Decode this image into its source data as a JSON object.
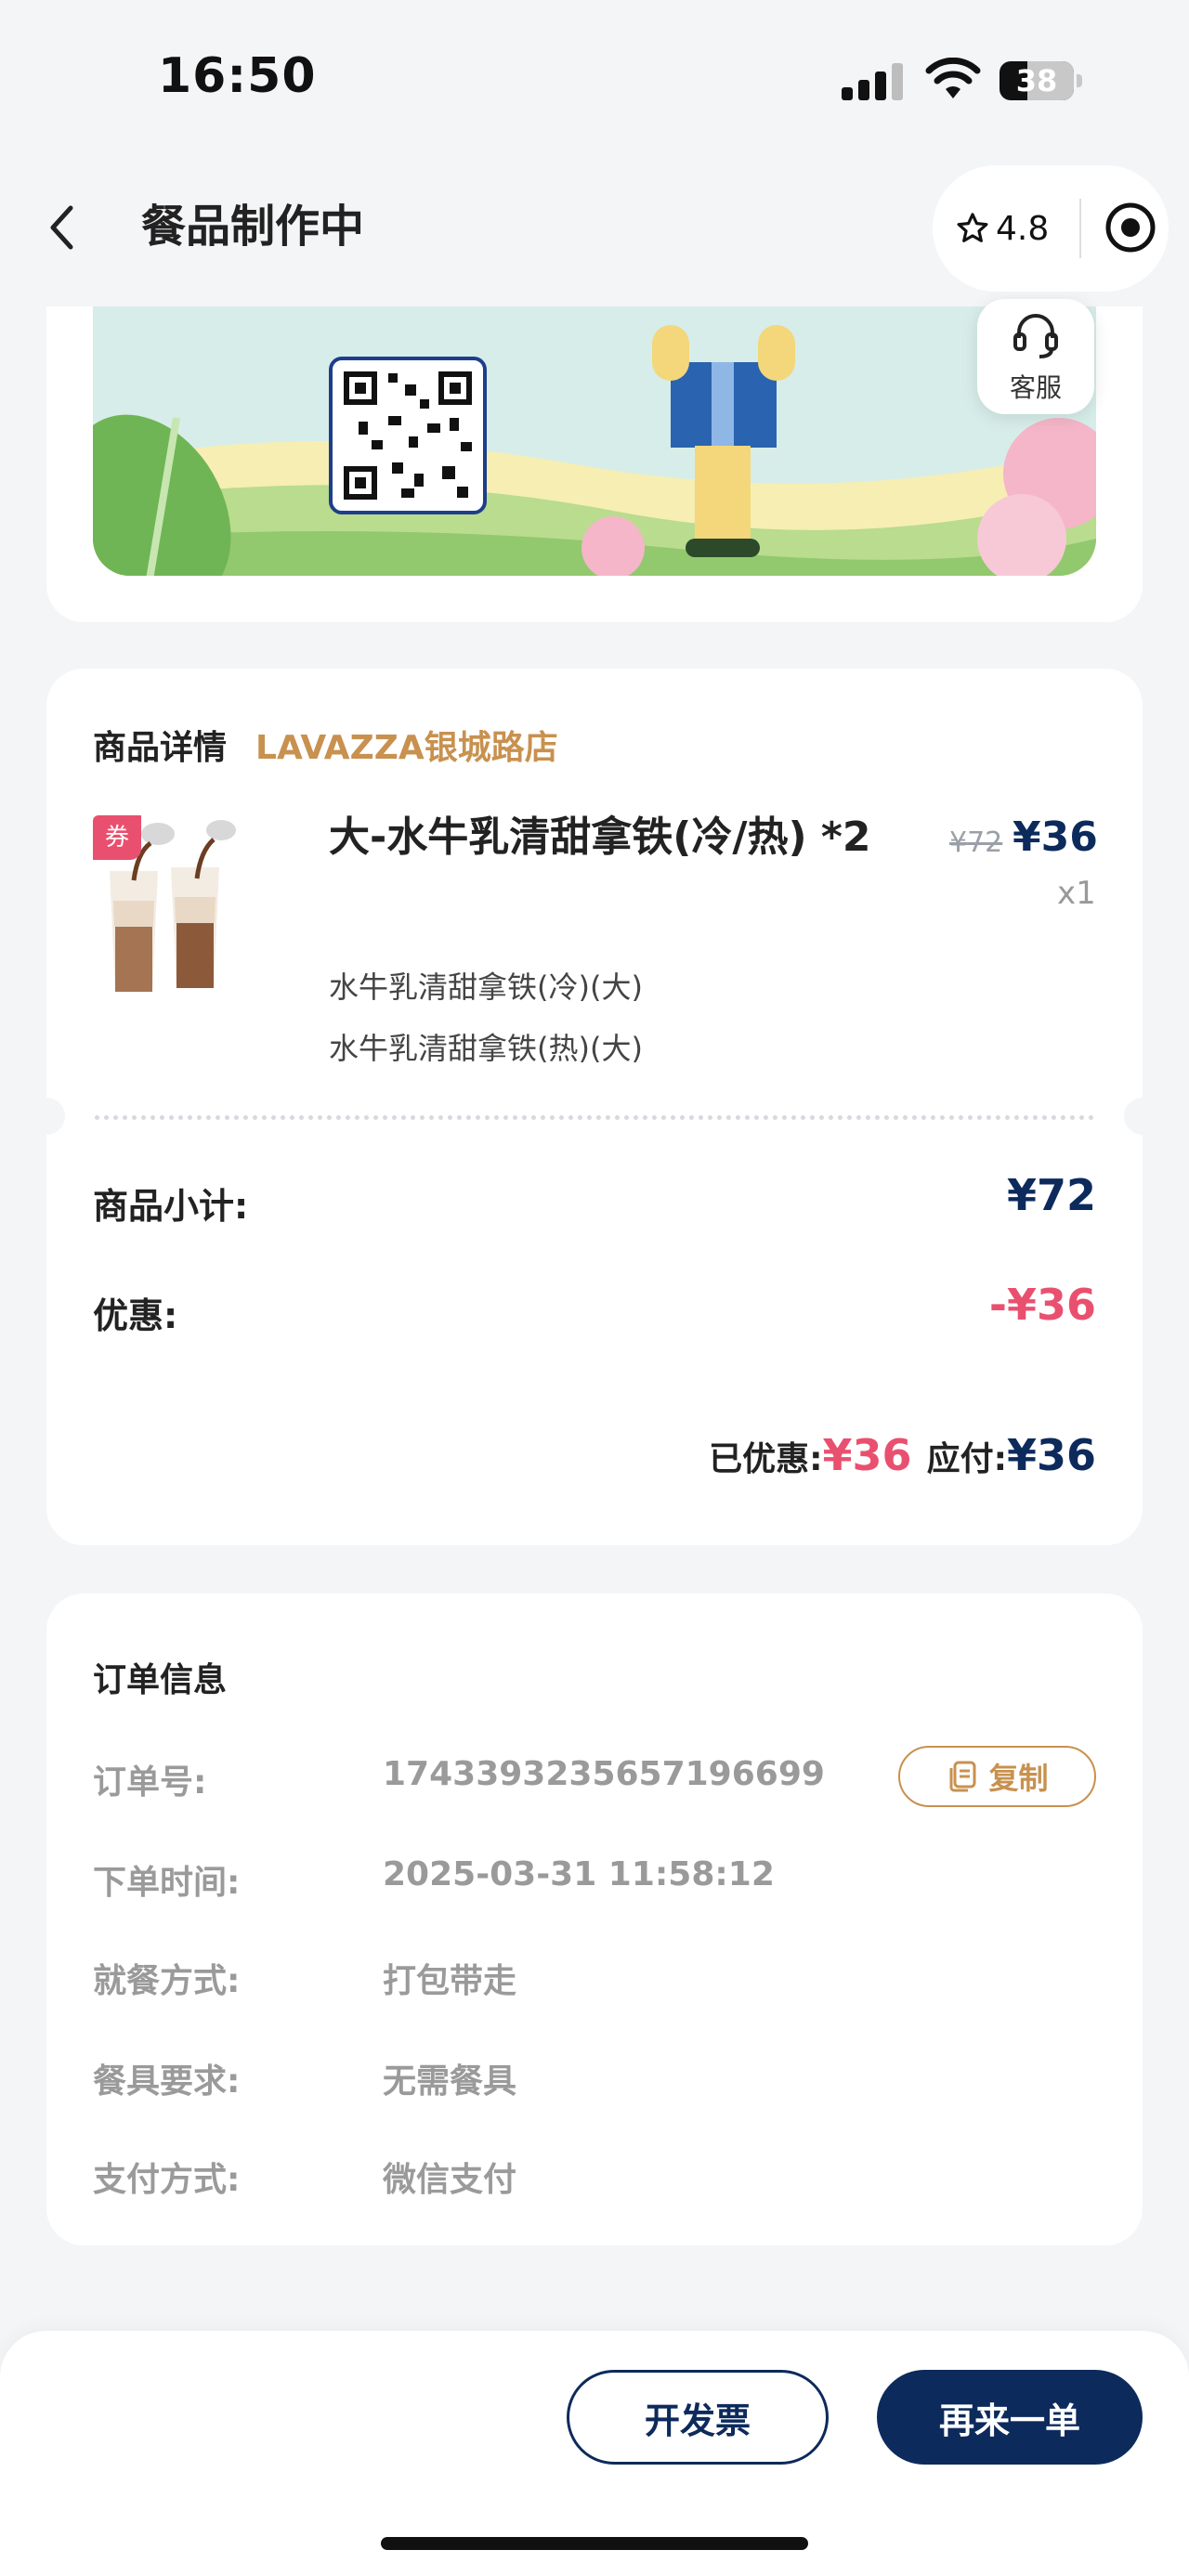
{
  "status_bar": {
    "time": "16:50",
    "battery": "38"
  },
  "nav": {
    "title": "餐品制作中",
    "rating": "4.8"
  },
  "banner": {
    "service_label": "客服"
  },
  "product": {
    "heading": "商品详情",
    "store": "LAVAZZA银城路店",
    "coupon_tag": "券",
    "name": "大-水牛乳清甜拿铁(冷/热) *2",
    "original_price": "¥72",
    "price": "¥36",
    "quantity": "x1",
    "specs": [
      "水牛乳清甜拿铁(冷)(大)",
      "水牛乳清甜拿铁(热)(大)"
    ],
    "subtotal_label": "商品小计:",
    "subtotal_value": "¥72",
    "discount_label": "优惠:",
    "discount_value": "-¥36",
    "saved_label": "已优惠:",
    "saved_value": "¥36",
    "payable_label": "应付:",
    "payable_value": "¥36"
  },
  "order": {
    "heading": "订单信息",
    "copy_label": "复制",
    "rows": [
      {
        "label": "订单号:",
        "value": "1743393235657196699"
      },
      {
        "label": "下单时间:",
        "value": "2025-03-31 11:58:12"
      },
      {
        "label": "就餐方式:",
        "value": "打包带走"
      },
      {
        "label": "餐具要求:",
        "value": "无需餐具"
      },
      {
        "label": "支付方式:",
        "value": "微信支付"
      }
    ]
  },
  "actions": {
    "invoice": "开发票",
    "reorder": "再来一单"
  },
  "colors": {
    "navy": "#0d2a5c",
    "gold": "#c8914f",
    "pink": "#e9506f",
    "background": "#f4f5f7"
  }
}
